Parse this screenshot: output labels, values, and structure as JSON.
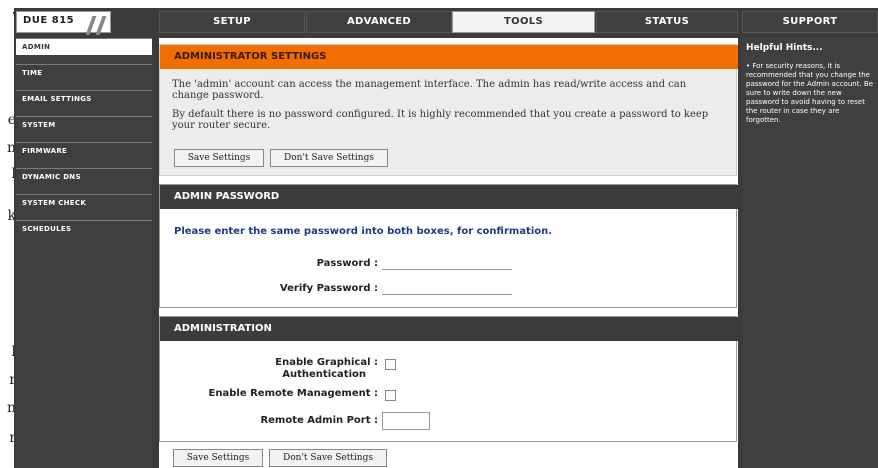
{
  "margin_fragments": [
    ".",
    "e",
    "n",
    "l",
    "k",
    "l",
    "r",
    "n",
    "r"
  ],
  "model": "DUE 815",
  "tabs": [
    {
      "label": "SETUP"
    },
    {
      "label": "ADVANCED"
    },
    {
      "label": "TOOLS"
    },
    {
      "label": "STATUS"
    },
    {
      "label": "SUPPORT"
    }
  ],
  "active_tab": "TOOLS",
  "sidebar": {
    "items": [
      {
        "label": "ADMIN"
      },
      {
        "label": "TIME"
      },
      {
        "label": "EMAIL SETTINGS"
      },
      {
        "label": "SYSTEM"
      },
      {
        "label": "FIRMWARE"
      },
      {
        "label": "DYNAMIC DNS"
      },
      {
        "label": "SYSTEM CHECK"
      },
      {
        "label": "SCHEDULES"
      }
    ]
  },
  "admin_settings": {
    "title": "ADMINISTRATOR SETTINGS",
    "paragraph1": "The 'admin' account can access the management interface. The admin has read/write access and can change password.",
    "paragraph2": "By default there is no password configured. It is highly recommended that you create a password to keep your router secure.",
    "save_label": "Save Settings",
    "dont_save_label": "Don't Save Settings"
  },
  "admin_password": {
    "title": "ADMIN PASSWORD",
    "instruction": "Please enter the same password into both boxes, for confirmation.",
    "password_label": "Password :",
    "verify_label": "Verify Password :",
    "password_value": "",
    "verify_value": ""
  },
  "administration": {
    "title": "ADMINISTRATION",
    "graphical_auth_label_line1": "Enable Graphical :",
    "graphical_auth_label_line2": "Authentication",
    "remote_mgmt_label": "Enable Remote Management :",
    "remote_port_label": "Remote Admin Port :",
    "remote_port_value": ""
  },
  "bottom_buttons": {
    "save_label": "Save Settings",
    "dont_save_label": "Don't Save Settings"
  },
  "hints": {
    "title": "Helpful Hints...",
    "text": "• For security reasons, it is recommended that you change the password for the Admin account. Be sure to write down the new password to avoid having to reset the router in case they are forgotten."
  },
  "colors": {
    "frame": "#3b3b3b",
    "accent_orange": "#f06f00",
    "instruction_blue": "#1b3c82"
  }
}
